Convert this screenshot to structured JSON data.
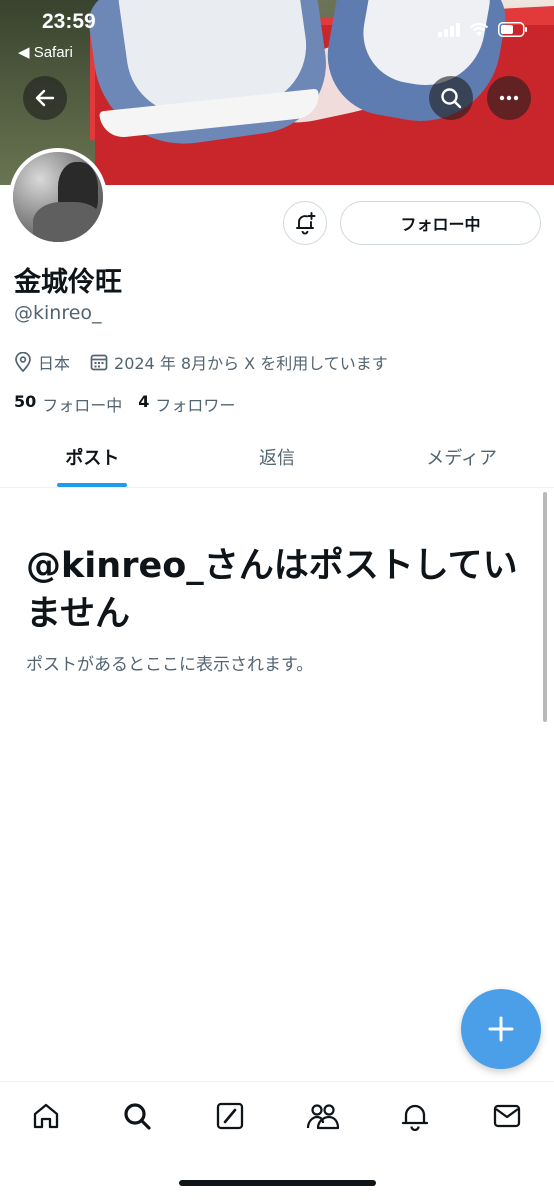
{
  "status_bar": {
    "time": "23:59",
    "back_app": "◀ Safari"
  },
  "header": {
    "back_icon": "arrow-left-icon",
    "search_icon": "search-icon",
    "more_icon": "more-horizontal-icon"
  },
  "profile": {
    "display_name": "金城伶旺",
    "handle": "@kinreo_",
    "location": "日本",
    "joined": "2024 年 8月から X を利用しています",
    "following_count": "50",
    "following_label": "フォロー中",
    "followers_count": "4",
    "followers_label": "フォロワー",
    "follow_button_label": "フォロー中"
  },
  "tabs": [
    {
      "label": "ポスト",
      "active": true
    },
    {
      "label": "返信",
      "active": false
    },
    {
      "label": "メディア",
      "active": false
    }
  ],
  "empty_state": {
    "title": "@kinreo_さんはポストしていません",
    "subtitle": "ポストがあるとここに表示されます。"
  },
  "bottom_nav": [
    {
      "icon": "home-icon"
    },
    {
      "icon": "search-icon"
    },
    {
      "icon": "grok-icon"
    },
    {
      "icon": "communities-icon"
    },
    {
      "icon": "notifications-icon"
    },
    {
      "icon": "messages-icon"
    }
  ],
  "colors": {
    "accent": "#1d9bf0",
    "fab": "#4a9fe8",
    "secondary_text": "#536471"
  }
}
